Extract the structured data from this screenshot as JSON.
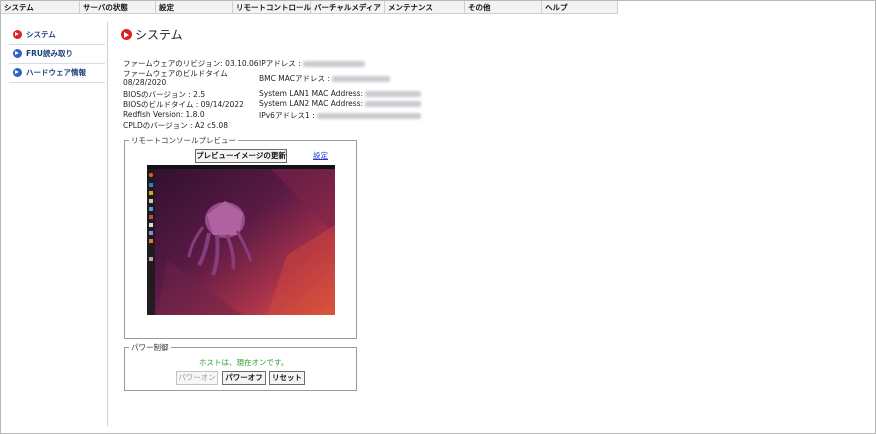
{
  "menu": {
    "items": [
      "システム",
      "サーバの状態",
      "設定",
      "リモートコントロール",
      "バーチャルメディア",
      "メンテナンス",
      "その他",
      "ヘルプ"
    ]
  },
  "sidebar": {
    "items": [
      {
        "label": "システム",
        "icon": "red-arrow-circle-icon",
        "color": "#e02020"
      },
      {
        "label": "FRU読み取り",
        "icon": "blue-arrow-circle-icon",
        "color": "#2c63c4"
      },
      {
        "label": "ハードウェア情報",
        "icon": "blue-arrow-circle-icon",
        "color": "#2c63c4"
      }
    ]
  },
  "page": {
    "title": "システム"
  },
  "info": {
    "fw_revision": "ファームウェアのリビジョン: 03.10.06",
    "fw_build_time_label": "ファームウェアのビルドタイム",
    "fw_build_time_value": "08/28/2020",
    "bios_version": "BIOSのバージョン : 2.5",
    "bios_build_time": "BIOSのビルドタイム : 09/14/2022",
    "redfish_version": "Redfish Version: 1.8.0",
    "cpld_version": "CPLDのバージョン : A2 c5.08",
    "ip_label": "IPアドレス :",
    "bmc_mac_label": "BMC MACアドレス :",
    "lan1_label": "System LAN1 MAC Address:",
    "lan2_label": "System LAN2 MAC Address:",
    "ipv6_label": "IPv6アドレス1 :"
  },
  "console": {
    "legend": "リモートコンソールプレビュー",
    "refresh_button": "プレビューイメージの更新",
    "settings_link": "設定"
  },
  "power": {
    "legend": "パワー制御",
    "status": "ホストは、現在オンです。",
    "power_on": "パワーオン",
    "power_off": "パワーオフ",
    "reset": "リセット"
  }
}
